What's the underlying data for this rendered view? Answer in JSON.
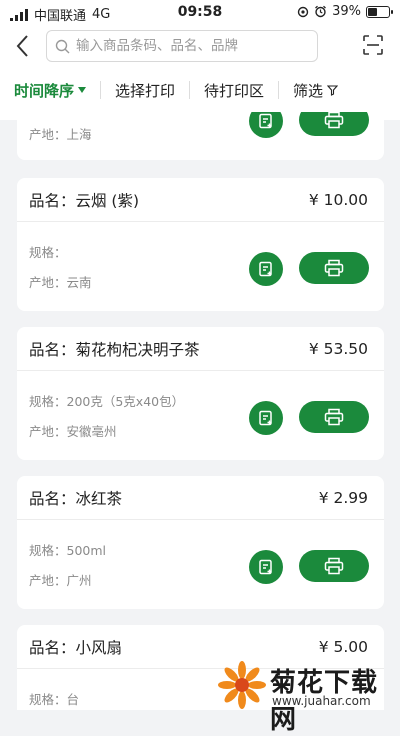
{
  "status": {
    "carrier": "中国联通",
    "network": "4G",
    "time": "09:58",
    "battery": "39%",
    "battery_level": 0.39
  },
  "search": {
    "placeholder": "输入商品条码、品名、品牌"
  },
  "filters": [
    {
      "label": "时间降序",
      "active": true
    },
    {
      "label": "选择打印",
      "active": false
    },
    {
      "label": "待打印区",
      "active": false
    },
    {
      "label": "筛选",
      "active": false
    }
  ],
  "colors": {
    "accent": "#1b8a3c"
  },
  "products": [
    {
      "origin": "产地：上海"
    },
    {
      "name": "品名：云烟 (紫)",
      "price": "¥ 10.00",
      "spec": "规格：",
      "origin": "产地：云南"
    },
    {
      "name": "品名：菊花枸杞决明子茶",
      "price": "¥ 53.50",
      "spec": "规格：200克（5克x40包）",
      "origin": "产地：安徽亳州"
    },
    {
      "name": "品名：冰红茶",
      "price": "¥ 2.99",
      "spec": "规格：500ml",
      "origin": "产地：广州"
    },
    {
      "name": "品名：小风扇",
      "price": "¥ 5.00",
      "spec": "规格：台"
    }
  ],
  "watermark": {
    "title": "菊花下载网",
    "url": "www.juahar.com"
  }
}
